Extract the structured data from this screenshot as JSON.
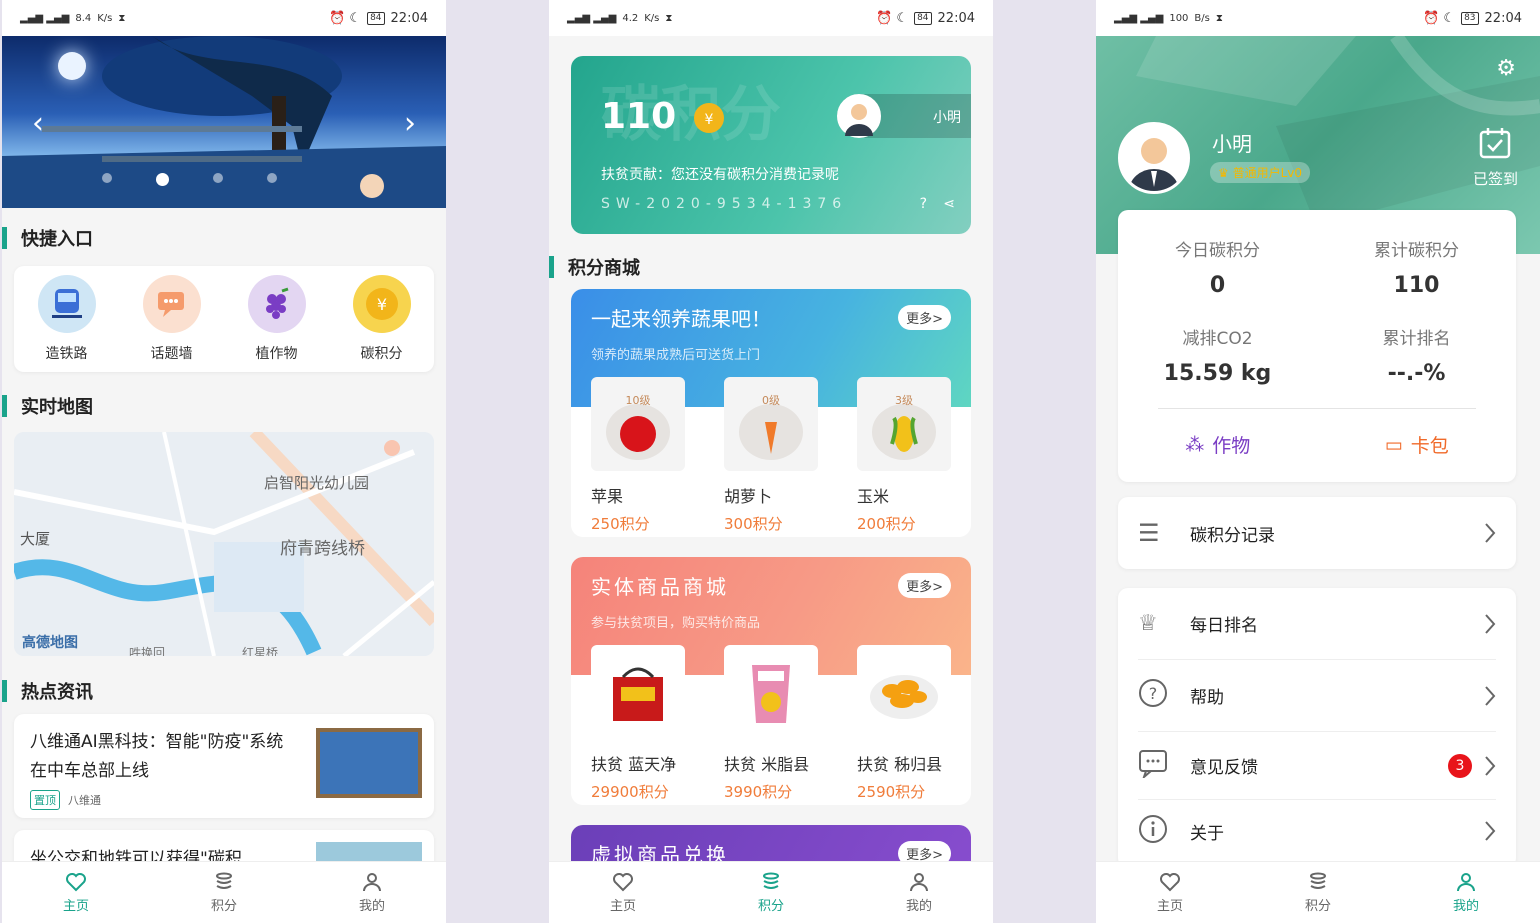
{
  "status_bars": [
    {
      "net": "8.4",
      "net_unit": "K/s",
      "time": "22:04",
      "battery": "84"
    },
    {
      "net": "4.2",
      "net_unit": "K/s",
      "time": "22:04",
      "battery": "84"
    },
    {
      "net": "100",
      "net_unit": "B/s",
      "time": "22:04",
      "battery": "83"
    }
  ],
  "home": {
    "quick_title": "快捷入口",
    "quick": [
      {
        "label": "造铁路",
        "icon": "train-icon"
      },
      {
        "label": "话题墙",
        "icon": "chat-icon"
      },
      {
        "label": "植作物",
        "icon": "grape-icon"
      },
      {
        "label": "碳积分",
        "icon": "coin-icon"
      }
    ],
    "map_title": "实时地图",
    "map_labels": [
      "启智阳光幼儿园",
      "府青跨线桥",
      "大厦",
      "高德地图",
      "吽换回",
      "红星桥"
    ],
    "news_title": "热点资讯",
    "news": [
      {
        "title": "八维通AI黑科技：智能\"防疫\"系统在中车总部上线",
        "tag": "置顶",
        "source": "八维通"
      },
      {
        "title": "坐公交和地铁可以获得\"碳积"
      }
    ]
  },
  "points": {
    "card": {
      "score": "110",
      "watermark": "碳积分",
      "user": "小明",
      "contribution": "扶贫贡献：您还没有碳积分消费记录呢",
      "code": "SW-2020-9534-1376"
    },
    "mall_title": "积分商城",
    "shops": [
      {
        "title": "一起来领养蔬果吧！",
        "sub": "领养的蔬果成熟后可送货上门",
        "more": "更多>",
        "items": [
          {
            "name": "苹果",
            "price": "250积分",
            "level": "10级",
            "color": "#d8141a"
          },
          {
            "name": "胡萝卜",
            "price": "300积分",
            "level": "0级",
            "color": "#f07a2a"
          },
          {
            "name": "玉米",
            "price": "200积分",
            "level": "3级",
            "color": "#f2c11a"
          }
        ]
      },
      {
        "title": "实体商品商城",
        "sub": "参与扶贫项目，购买特价商品",
        "more": "更多>",
        "items": [
          {
            "name": "扶贫 蓝天净",
            "price": "29900积分",
            "color": "#c81a1a"
          },
          {
            "name": "扶贫 米脂县",
            "price": "3990积分",
            "color": "#e88cb2"
          },
          {
            "name": "扶贫 秭归县",
            "price": "2590积分",
            "color": "#f5a011"
          }
        ]
      },
      {
        "title": "虚拟商品兑换",
        "more": "更多>"
      }
    ]
  },
  "mine": {
    "name": "小明",
    "level": "普通用户Lv0",
    "checkin": "已签到",
    "stats": [
      {
        "label": "今日碳积分",
        "value": "0"
      },
      {
        "label": "累计碳积分",
        "value": "110"
      },
      {
        "label": "减排CO2",
        "value": "15.59 kg"
      },
      {
        "label": "累计排名",
        "value": "--.-%"
      }
    ],
    "shortcuts": [
      {
        "label": "作物"
      },
      {
        "label": "卡包"
      }
    ],
    "menu": [
      {
        "label": "碳积分记录"
      },
      {
        "label": "每日排名"
      },
      {
        "label": "帮助"
      },
      {
        "label": "意见反馈",
        "badge": "3"
      },
      {
        "label": "关于"
      }
    ]
  },
  "tabs": [
    "主页",
    "积分",
    "我的"
  ],
  "colors": {
    "accent": "#1aa38b",
    "price": "#f07c3a",
    "badge": "#e8141a"
  }
}
